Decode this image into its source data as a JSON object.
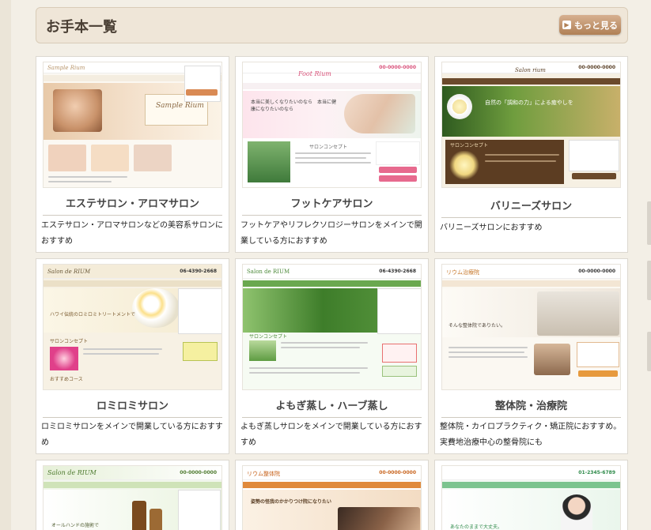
{
  "header": {
    "title": "お手本一覧",
    "more_label": "もっと見る"
  },
  "cards": [
    {
      "title": "エステサロン・アロマサロン",
      "desc": "エステサロン・アロマサロンなどの美容系サロンにおすすめ",
      "logo": "Sample Rium",
      "hero_text": "Sample Rium"
    },
    {
      "title": "フットケアサロン",
      "desc": "フットケアやリフレクソロジーサロンをメインで開業している方におすすめ",
      "logo": "Foot Rium",
      "tel": "00-0000-0000",
      "hero_text": "本当に美しくなりたいのなら　本当に健康になりたいのなら",
      "section": "サロンコンセプト"
    },
    {
      "title": "バリニーズサロン",
      "desc": "バリニーズサロンにおすすめ",
      "logo": "Salon rium",
      "tel": "00-0000-0000",
      "hero_text": "自然の「調和の力」による癒やしを",
      "section": "サロンコンセプト"
    },
    {
      "title": "ロミロミサロン",
      "desc": "ロミロミサロンをメインで開業している方におすすめ",
      "logo": "Salon de RIUM",
      "tel": "06-4390-2668",
      "hero_text": "ハワイ伝統のロミロミトリートメントで",
      "section": "サロンコンセプト",
      "section2": "おすすめコース"
    },
    {
      "title": "よもぎ蒸し・ハーブ蒸し",
      "desc": "よもぎ蒸しサロンをメインで開業している方におすすめ",
      "logo": "Salon de RIUM",
      "tel": "06-4390-2668",
      "section": "サロンコンセプト"
    },
    {
      "title": "整体院・治療院",
      "desc": "整体院・カイロプラクティク・矯正院におすすめ。実費地治療中心の整骨院にも",
      "logo": "リウム治療院",
      "tel": "00-0000-0000",
      "hero_text": "そんな整体院でありたい。"
    },
    {
      "logo": "Salon de RIUM",
      "tel": "00-0000-0000",
      "hero_text": "オールハンドの施術で"
    },
    {
      "logo": "リウム整体院",
      "tel": "00-0000-0000",
      "hero_text": "姿勢の怪我のかかりつけ院になりたい"
    },
    {
      "logo": "",
      "tel": "01-2345-6789",
      "hero_text": "あなたのままで大丈夫。"
    }
  ],
  "colors": {
    "accent": "#b08055",
    "header_bg": "#efe6d8",
    "text": "#222222"
  }
}
